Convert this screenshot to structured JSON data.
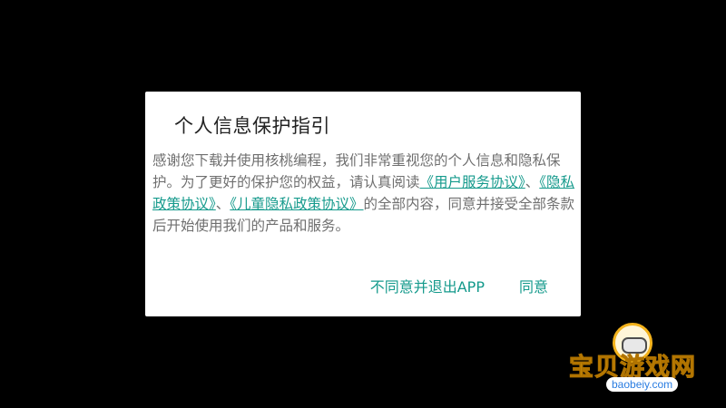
{
  "dialog": {
    "title": "个人信息保护指引",
    "body": {
      "text_1": "感谢您下载并使用核桃编程，我们非常重视您的个人信息和隐私保护。为了更好的保护您的权益，请认真阅读",
      "link_user_agreement": "《用户服务协议》",
      "sep_1": "、",
      "link_privacy_policy": "《隐私政策协议》",
      "sep_2": "、",
      "link_child_privacy": "《儿童隐私政策协议》",
      "text_2": "的全部内容，同意并接受全部条款后开始使用我们的产品和服务。"
    },
    "buttons": {
      "decline_label": "不同意并退出APP",
      "agree_label": "同意"
    }
  },
  "watermark": {
    "title": "宝贝游戏网",
    "domain": "baobeiy.com",
    "icon": "gamepad-icon"
  },
  "colors": {
    "accent": "#159a8c",
    "body_text": "#6f6f6f",
    "title_text": "#222222",
    "background": "#000000"
  }
}
